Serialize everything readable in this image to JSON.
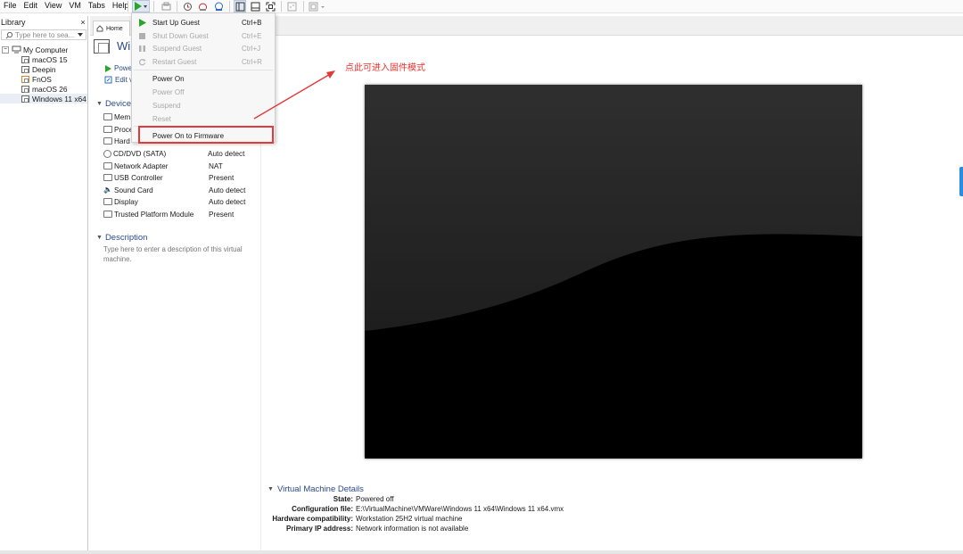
{
  "menubar": {
    "items": [
      "File",
      "Edit",
      "View",
      "VM",
      "Tabs",
      "Help"
    ]
  },
  "library": {
    "title": "Library",
    "close": "×",
    "search_placeholder": "Type here to sea...",
    "root": "My Computer",
    "vms": [
      "macOS 15",
      "Deepin",
      "FnOS",
      "macOS 26",
      "Windows 11 x64"
    ]
  },
  "tabs": {
    "home": "Home"
  },
  "vm": {
    "title": "Win",
    "actions": [
      "Powe",
      "Edit v"
    ]
  },
  "devices": {
    "heading": "Device",
    "items": [
      {
        "name": "Mem",
        "value": ""
      },
      {
        "name": "Proce",
        "value": ""
      },
      {
        "name": "Hard",
        "value": ""
      },
      {
        "name": "CD/DVD (SATA)",
        "value": "Auto detect"
      },
      {
        "name": "Network Adapter",
        "value": "NAT"
      },
      {
        "name": "USB Controller",
        "value": "Present"
      },
      {
        "name": "Sound Card",
        "value": "Auto detect"
      },
      {
        "name": "Display",
        "value": "Auto detect"
      },
      {
        "name": "Trusted Platform Module",
        "value": "Present"
      }
    ]
  },
  "description": {
    "heading": "Description",
    "text": "Type here to enter a description of this virtual machine."
  },
  "details": {
    "heading": "Virtual Machine Details",
    "rows": [
      {
        "label": "State:",
        "value": "Powered off"
      },
      {
        "label": "Configuration file:",
        "value": "E:\\VirtualMachine\\VMWare\\Windows 11 x64\\Windows 11 x64.vmx"
      },
      {
        "label": "Hardware compatibility:",
        "value": "Workstation 25H2 virtual machine"
      },
      {
        "label": "Primary IP address:",
        "value": "Network information is not available"
      }
    ]
  },
  "dropdown": {
    "items": [
      {
        "label": "Start Up Guest",
        "shortcut": "Ctrl+B",
        "enabled": true,
        "icon": "play-icon"
      },
      {
        "label": "Shut Down Guest",
        "shortcut": "Ctrl+E",
        "enabled": false,
        "icon": "stop-icon"
      },
      {
        "label": "Suspend Guest",
        "shortcut": "Ctrl+J",
        "enabled": false,
        "icon": "pause-icon"
      },
      {
        "label": "Restart Guest",
        "shortcut": "Ctrl+R",
        "enabled": false,
        "icon": "restart-icon"
      },
      {
        "label": "Power On",
        "shortcut": "",
        "enabled": true
      },
      {
        "label": "Power Off",
        "shortcut": "",
        "enabled": false
      },
      {
        "label": "Suspend",
        "shortcut": "",
        "enabled": false
      },
      {
        "label": "Reset",
        "shortcut": "",
        "enabled": false
      },
      {
        "label": "Power On to Firmware",
        "shortcut": "",
        "enabled": true
      }
    ]
  },
  "annotation": {
    "text": "点此可进入固件模式",
    "color": "#e8332f"
  },
  "colors": {
    "accent": "#2b4a8a",
    "play": "#2aa52a",
    "highlight": "#e03a3a"
  }
}
